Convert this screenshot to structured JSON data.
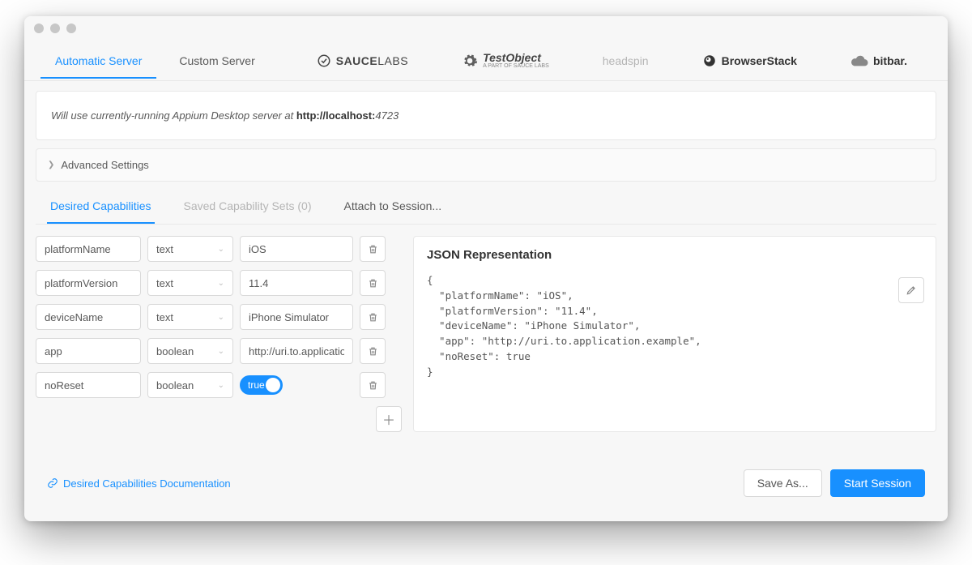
{
  "serverTabs": [
    {
      "label": "Automatic Server"
    },
    {
      "label": "Custom Server"
    },
    {
      "label": "SAUCELABS"
    },
    {
      "label": "TestObject",
      "sub": "A PART OF SAUCE LABS"
    },
    {
      "label": "headspin"
    },
    {
      "label": "BrowserStack"
    },
    {
      "label": "bitbar."
    }
  ],
  "info": {
    "prefix": "Will use currently-running Appium Desktop server at ",
    "host": "http://localhost:",
    "port": "4723"
  },
  "advanced": {
    "label": "Advanced Settings"
  },
  "capsTabs": [
    {
      "label": "Desired Capabilities"
    },
    {
      "label": "Saved Capability Sets (0)"
    },
    {
      "label": "Attach to Session..."
    }
  ],
  "caps": [
    {
      "name": "platformName",
      "type": "text",
      "value": "iOS",
      "kind": "text"
    },
    {
      "name": "platformVersion",
      "type": "text",
      "value": "11.4",
      "kind": "text"
    },
    {
      "name": "deviceName",
      "type": "text",
      "value": "iPhone Simulator",
      "kind": "text"
    },
    {
      "name": "app",
      "type": "boolean",
      "value": "http://uri.to.application",
      "kind": "text"
    },
    {
      "name": "noReset",
      "type": "boolean",
      "value": "true",
      "kind": "toggle"
    }
  ],
  "json": {
    "title": "JSON Representation",
    "body": "{\n  \"platformName\": \"iOS\",\n  \"platformVersion\": \"11.4\",\n  \"deviceName\": \"iPhone Simulator\",\n  \"app\": \"http://uri.to.application.example\",\n  \"noReset\": true\n}"
  },
  "footer": {
    "docLink": "Desired Capabilities Documentation",
    "saveAs": "Save As...",
    "start": "Start Session"
  }
}
